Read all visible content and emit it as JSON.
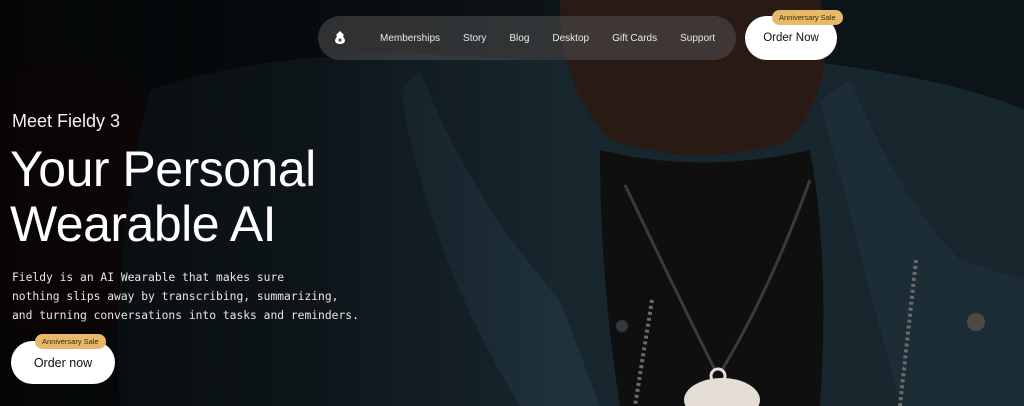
{
  "nav": {
    "logo_icon": "fieldy-logo-icon",
    "items": [
      {
        "label": "Memberships"
      },
      {
        "label": "Story"
      },
      {
        "label": "Blog"
      },
      {
        "label": "Desktop"
      },
      {
        "label": "Gift Cards"
      },
      {
        "label": "Support"
      }
    ],
    "cta_label": "Order Now",
    "cta_badge": "Anniversary Sale"
  },
  "hero": {
    "eyebrow": "Meet Fieldy 3",
    "headline_lines": [
      "Your Personal",
      "Wearable AI"
    ],
    "description_lines": [
      "Fieldy is an AI Wearable that makes sure",
      "nothing slips away by transcribing, summarizing,",
      "and turning conversations into tasks and reminders."
    ],
    "cta_label": "Order now",
    "cta_badge": "Anniversary Sale"
  },
  "colors": {
    "badge": "#e8b969",
    "button": "#ffffff",
    "nav_bg": "#505050"
  }
}
